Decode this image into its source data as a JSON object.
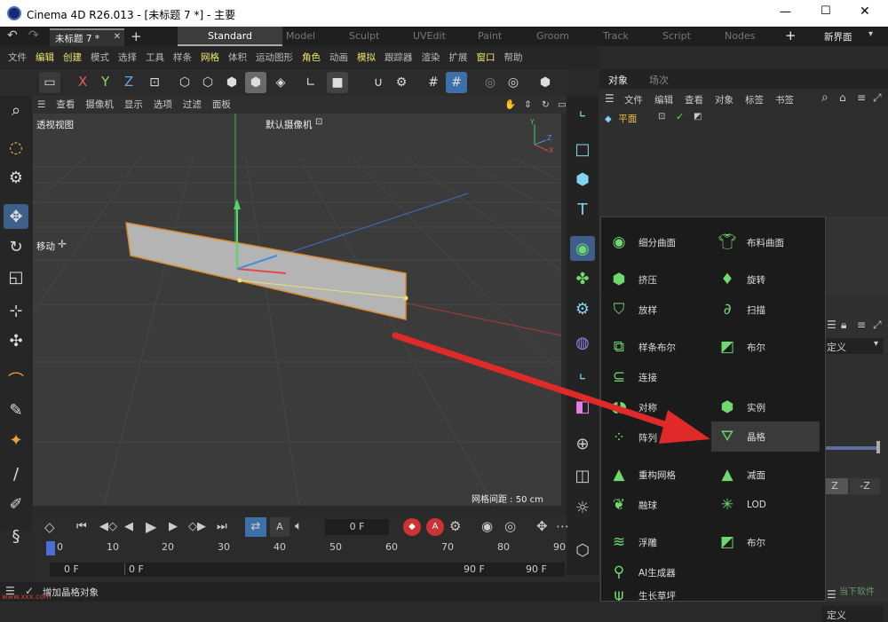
{
  "window": {
    "title": "Cinema 4D R26.013 - [未标题 7 *] - 主要",
    "min": "—",
    "max": "☐",
    "close": "✕"
  },
  "tabs": {
    "doc_tab": "未标题 7 *",
    "add": "+",
    "layouts": [
      "Standard",
      "Model",
      "Sculpt",
      "UVEdit",
      "Paint",
      "Groom",
      "Track",
      "Script",
      "Nodes"
    ],
    "add_layout": "+",
    "new_layout": "新界面"
  },
  "menu": [
    "文件",
    "编辑",
    "创建",
    "模式",
    "选择",
    "工具",
    "样条",
    "网格",
    "体积",
    "运动图形",
    "角色",
    "动画",
    "模拟",
    "跟踪器",
    "渲染",
    "扩展",
    "窗口",
    "帮助"
  ],
  "toolbar": {
    "x": "X",
    "y": "Y",
    "z": "Z"
  },
  "viewport": {
    "menu": [
      "查看",
      "摄像机",
      "显示",
      "选项",
      "过滤",
      "面板"
    ],
    "view_label": "透视视图",
    "camera_label": "默认摄像机",
    "move_label": "移动",
    "grid_spacing": "网格间距 : 50 cm"
  },
  "timeline": {
    "frame_field": "0 F",
    "ticks": [
      "0",
      "10",
      "20",
      "30",
      "40",
      "50",
      "60",
      "70",
      "80",
      "90"
    ],
    "start1": "0 F",
    "start2": "0 F",
    "end1": "90 F",
    "end2": "90 F"
  },
  "status": {
    "text": "增加晶格对象"
  },
  "objects": {
    "tabs": [
      "对象",
      "场次"
    ],
    "menu": [
      "文件",
      "编辑",
      "查看",
      "对象",
      "标签",
      "书签"
    ],
    "item": "平面"
  },
  "attr": {
    "label1": "定义",
    "label2": "定义",
    "z": "Z",
    "nz": "-Z"
  },
  "popup": {
    "items": [
      {
        "label": "细分曲面",
        "icon": "subdivision-icon"
      },
      {
        "label": "布料曲面",
        "icon": "cloth-surface-icon"
      },
      {
        "label": "挤压",
        "icon": "extrude-icon"
      },
      {
        "label": "旋转",
        "icon": "lathe-icon"
      },
      {
        "label": "放样",
        "icon": "loft-icon"
      },
      {
        "label": "扫描",
        "icon": "sweep-icon"
      },
      {
        "label": "样条布尔",
        "icon": "spline-boolean-icon"
      },
      {
        "label": "布尔",
        "icon": "boolean-icon"
      },
      {
        "label": "连接",
        "icon": "connect-icon"
      },
      {
        "label": "对称",
        "icon": "symmetry-icon"
      },
      {
        "label": "实例",
        "icon": "instance-icon"
      },
      {
        "label": "阵列",
        "icon": "array-icon"
      },
      {
        "label": "晶格",
        "icon": "atom-array-icon"
      },
      {
        "label": "重构网格",
        "icon": "remesh-icon"
      },
      {
        "label": "减面",
        "icon": "polygon-reduction-icon"
      },
      {
        "label": "融球",
        "icon": "metaball-icon"
      },
      {
        "label": "LOD",
        "icon": "lod-icon"
      },
      {
        "label": "浮雕",
        "icon": "relief-icon"
      },
      {
        "label": "布尔",
        "icon": "boolean-icon"
      },
      {
        "label": "AI生成器",
        "icon": "ai-generator-icon"
      },
      {
        "label": "生长草坪",
        "icon": "grass-icon"
      }
    ]
  },
  "watermark": "www.xxx.com",
  "brand": "当下软件"
}
